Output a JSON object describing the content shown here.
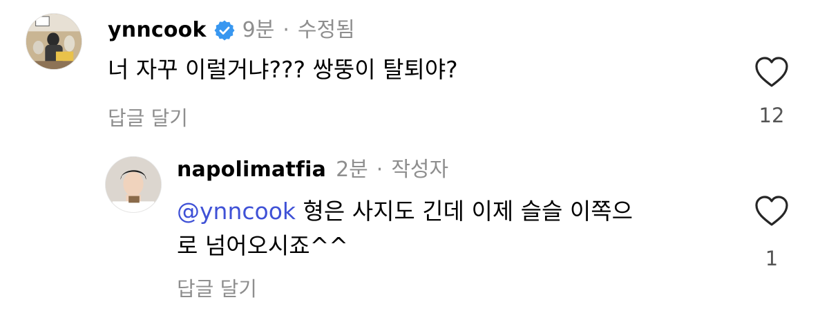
{
  "comments": [
    {
      "username": "ynncook",
      "verified": true,
      "time": "9분",
      "edited": "수정됨",
      "text": "너 자꾸 이럴거냐??? 쌍뚱이 탈퇴야?",
      "reply_label": "답글 달기",
      "like_count": "12",
      "icons": {
        "verified": "verified-badge-icon",
        "like": "heart-outline-icon"
      },
      "colors": {
        "verified": "#3897f0"
      }
    },
    {
      "username": "napolimatfia",
      "time": "2분",
      "author_tag": "작성자",
      "mention": "@ynncook",
      "text_line1": "형은 사지도 긴데 이제 슬슬 이쪽으",
      "text_line2": "로 넘어오시죠^^",
      "reply_label": "답글 달기",
      "like_count": "1",
      "icons": {
        "like": "heart-outline-icon"
      },
      "colors": {
        "mention": "#3f51d6"
      }
    }
  ]
}
